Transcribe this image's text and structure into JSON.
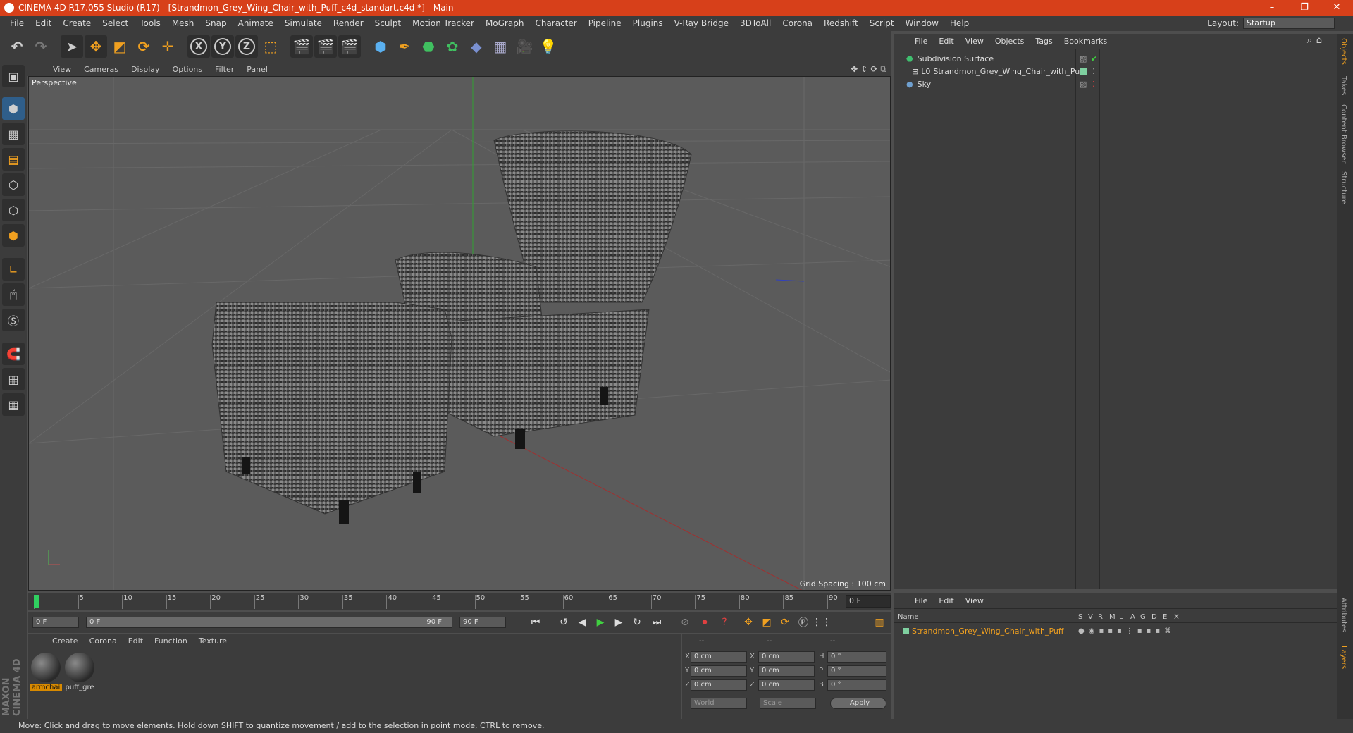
{
  "window": {
    "title": "CINEMA 4D R17.055 Studio (R17) - [Strandmon_Grey_Wing_Chair_with_Puff_c4d_standart.c4d *] - Main",
    "controls": [
      "–",
      "❐",
      "✕"
    ]
  },
  "menu": [
    "File",
    "Edit",
    "Create",
    "Select",
    "Tools",
    "Mesh",
    "Snap",
    "Animate",
    "Simulate",
    "Render",
    "Sculpt",
    "Motion Tracker",
    "MoGraph",
    "Character",
    "Pipeline",
    "Plugins",
    "V-Ray Bridge",
    "3DToAll",
    "Corona",
    "Redshift",
    "Script",
    "Window",
    "Help"
  ],
  "layout": {
    "label": "Layout:",
    "value": "Startup"
  },
  "toolbar": {
    "x": "X",
    "y": "Y",
    "z": "Z"
  },
  "viewport": {
    "menu": [
      "View",
      "Cameras",
      "Display",
      "Options",
      "Filter",
      "Panel"
    ],
    "label": "Perspective",
    "grid_spacing": "Grid Spacing : 100 cm"
  },
  "timeline": {
    "ticks": [
      "0",
      "5",
      "10",
      "15",
      "20",
      "25",
      "30",
      "35",
      "40",
      "45",
      "50",
      "55",
      "60",
      "65",
      "70",
      "75",
      "80",
      "85",
      "90"
    ],
    "current_frame": "0 F"
  },
  "transport": {
    "start": "0 F",
    "range_start": "0 F",
    "range_end": "90 F",
    "end": "90 F"
  },
  "materials": {
    "menu": [
      "Create",
      "Corona",
      "Edit",
      "Function",
      "Texture"
    ],
    "items": [
      {
        "name": "armchai",
        "selected": true
      },
      {
        "name": "puff_gre",
        "selected": false
      }
    ]
  },
  "coords": {
    "headers": [
      "--",
      "--",
      "--"
    ],
    "rows": [
      {
        "a": "X",
        "av": "0 cm",
        "b": "X",
        "bv": "0 cm",
        "c": "H",
        "cv": "0 °"
      },
      {
        "a": "Y",
        "av": "0 cm",
        "b": "Y",
        "bv": "0 cm",
        "c": "P",
        "cv": "0 °"
      },
      {
        "a": "Z",
        "av": "0 cm",
        "b": "Z",
        "bv": "0 cm",
        "c": "B",
        "cv": "0 °"
      }
    ],
    "world": "World",
    "scale": "Scale",
    "apply": "Apply"
  },
  "objects": {
    "menu": [
      "File",
      "Edit",
      "View",
      "Objects",
      "Tags",
      "Bookmarks"
    ],
    "items": [
      {
        "name": "Subdivision Surface",
        "indent": 0,
        "color": "#3fbf6f"
      },
      {
        "name": "Strandmon_Grey_Wing_Chair_with_Puff",
        "indent": 1,
        "color": "#7fd0a0"
      },
      {
        "name": "Sky",
        "indent": 0,
        "color": "#6fa0d0"
      }
    ]
  },
  "layers": {
    "menu": [
      "File",
      "Edit",
      "View"
    ],
    "columns": [
      "Name",
      "S",
      "V",
      "R",
      "M",
      "L",
      "A",
      "G",
      "D",
      "E",
      "X"
    ],
    "row": "Strandmon_Grey_Wing_Chair_with_Puff"
  },
  "right_tabs": [
    "Objects",
    "Takes",
    "Content Browser",
    "Structure",
    "Attributes",
    "Layers"
  ],
  "status": "Move: Click and drag to move elements. Hold down SHIFT to quantize movement / add to the selection in point mode, CTRL to remove.",
  "brand": "MAXON CINEMA 4D",
  "colors": {
    "titlebar": "#d7401a",
    "selection": "#d88a00",
    "accent": "#2f5e8a"
  }
}
